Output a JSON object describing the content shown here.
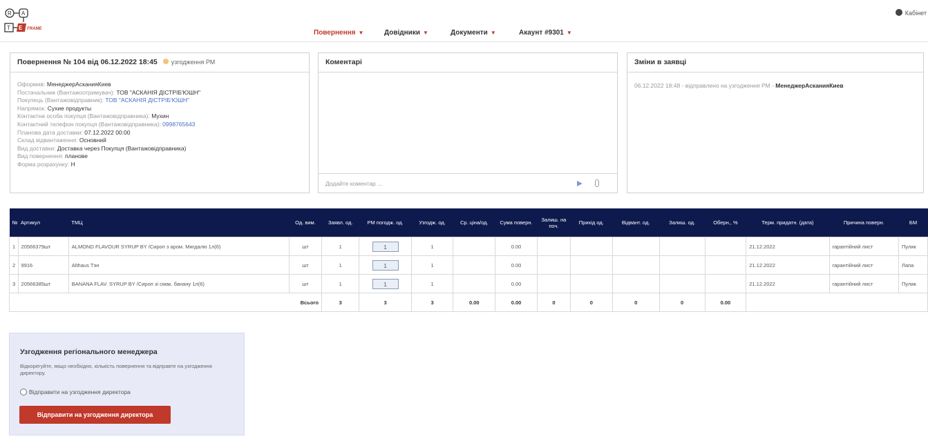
{
  "header": {
    "logo_text": "FRAME",
    "nav": [
      {
        "label": "Повернення",
        "active": true
      },
      {
        "label": "Довідники",
        "active": false
      },
      {
        "label": "Документи",
        "active": false
      },
      {
        "label": "Акаунт #9301",
        "active": false
      }
    ],
    "cabinet_label": "Кабінет",
    "accent_color": "#c0392b"
  },
  "request": {
    "title": "Повернення № 104 від 06.12.2022 18:45",
    "status": "узгодження РМ",
    "status_color": "#f5c27a",
    "fields": [
      {
        "label": "Оформив:",
        "value": "МенеджерАсканияКиев",
        "style": "val"
      },
      {
        "label": "Постачальник (Вантажоотримувач):",
        "value": "ТОВ \"АСКАНІЯ ДІСТРІБ'ЮШН\"",
        "style": "val"
      },
      {
        "label": "Покупець (Вантажовідправник):",
        "value": "ТОВ \"АСКАНІЯ ДІСТРІБ'ЮШН\"",
        "style": "lnk"
      },
      {
        "label": "Напрямок:",
        "value": "Сухие продукты",
        "style": "val"
      },
      {
        "label": "Контактна особа покупця (Вантажовідправника):",
        "value": "Мухин",
        "style": "val"
      },
      {
        "label": "Контактний телефон покупця (Вантажовідправника):",
        "value": "0998765643",
        "style": "lnk"
      },
      {
        "label": "Планова дата доставки:",
        "value": "07.12.2022 00:00",
        "style": "val"
      },
      {
        "label": "Склад відвантаження:",
        "value": "Основний",
        "style": "val"
      },
      {
        "label": "Вид доставки:",
        "value": "Доставка через Покупця (Вантажовідправника)",
        "style": "val"
      },
      {
        "label": "Вид повернення:",
        "value": "планове",
        "style": "val"
      },
      {
        "label": "Форма розрахунку:",
        "value": "Н",
        "style": "val"
      }
    ]
  },
  "comments": {
    "title": "Коментарі",
    "placeholder": "Додайте коментар ..."
  },
  "changes": {
    "title": "Зміни в заявці",
    "entry_text": "06.12.2022 18:48 - відправлено на узгодження РМ -",
    "entry_user": "МенеджерАсканияКиев"
  },
  "table": {
    "columns": [
      "№",
      "Артикул",
      "ТМЦ",
      "Од. вим.",
      "Заявл. од.",
      "РМ погодж. од.",
      "Узгодж. од.",
      "Ср. ціна/од.",
      "Сума поверн.",
      "Залиш. на поч.",
      "Прихід од.",
      "Відвант. од.",
      "Залиш. од.",
      "Оберн., %",
      "Терм. придатн. (дата)",
      "Причина поверн.",
      "БМ"
    ],
    "rows": [
      {
        "n": "1",
        "article": "20566379шт",
        "name": "ALMOND FLAVOUR SYRUP BY /Сироп з аром. Мигдалю 1л(6)",
        "unit": "шт",
        "declared": "1",
        "rm": "1",
        "agreed": "1",
        "sum": "0.00",
        "date": "21.12.2022",
        "reason": "гарантійний лист",
        "bm": "Пулик"
      },
      {
        "n": "2",
        "article": "9916",
        "name": "Althaus Тэн",
        "unit": "шт",
        "declared": "1",
        "rm": "1",
        "agreed": "1",
        "sum": "0.00",
        "date": "21.12.2022",
        "reason": "гарантійний лист",
        "bm": "Лапа"
      },
      {
        "n": "3",
        "article": "20566385шт",
        "name": "BANANA FLAV. SYRUP BY /Сироп зі смак. банану 1л(6)",
        "unit": "шт",
        "declared": "1",
        "rm": "1",
        "agreed": "1",
        "sum": "0.00",
        "date": "21.12.2022",
        "reason": "гарантійний лист",
        "bm": "Пулик"
      }
    ],
    "totals": {
      "label": "Всього",
      "declared": "3",
      "rm": "3",
      "agreed": "3",
      "price": "0.00",
      "sum": "0.00",
      "rest_start": "0",
      "income": "0",
      "shipped": "0",
      "rest": "0",
      "turnover": "0.00"
    }
  },
  "approval": {
    "title": "Узгодження регіонального менеджера",
    "description": "Відкорегуйте, якщо необхідно, кількість повернення та відправте на узгодження директору.",
    "radio_label": "Відправити на узгодження директора",
    "button_label": "Відправити на узгодження директора"
  }
}
